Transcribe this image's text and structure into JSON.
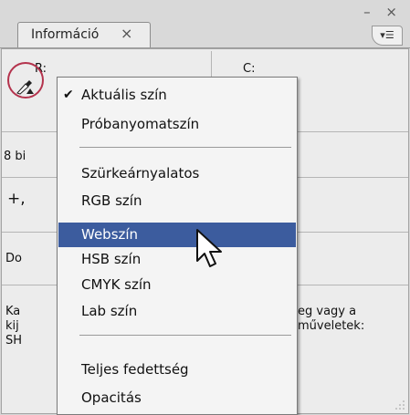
{
  "panel": {
    "tab_label": "Információ",
    "tab_close": "×",
    "window_controls": "– ×",
    "menu_button": "▾☰"
  },
  "info": {
    "r_label": "R:",
    "c_label": "C:",
    "bit_text": "8 bi",
    "crosshair": "+,",
    "doc_text": "Do",
    "desc_left_1": "Ka",
    "desc_left_2": "kij",
    "desc_left_3": "SH",
    "desc_right_1": "eg vagy a",
    "desc_right_2": "műveletek:"
  },
  "menu": {
    "items": [
      {
        "label": "Aktuális szín",
        "checked": true
      },
      {
        "label": "Próbanyomatszín"
      },
      {
        "label": "Szürkeárnyalatos"
      },
      {
        "label": "RGB szín"
      },
      {
        "label": "Webszín",
        "selected": true
      },
      {
        "label": "HSB szín"
      },
      {
        "label": "CMYK szín"
      },
      {
        "label": "Lab szín"
      },
      {
        "label": "Teljes fedettség"
      },
      {
        "label": "Opacitás"
      }
    ],
    "check_glyph": "✔"
  },
  "icons": {
    "eyedropper": "eyedropper-icon",
    "cursor": "arrow-cursor-icon"
  },
  "colors": {
    "highlight": "#3c5c9e",
    "circle": "#b4334d"
  }
}
